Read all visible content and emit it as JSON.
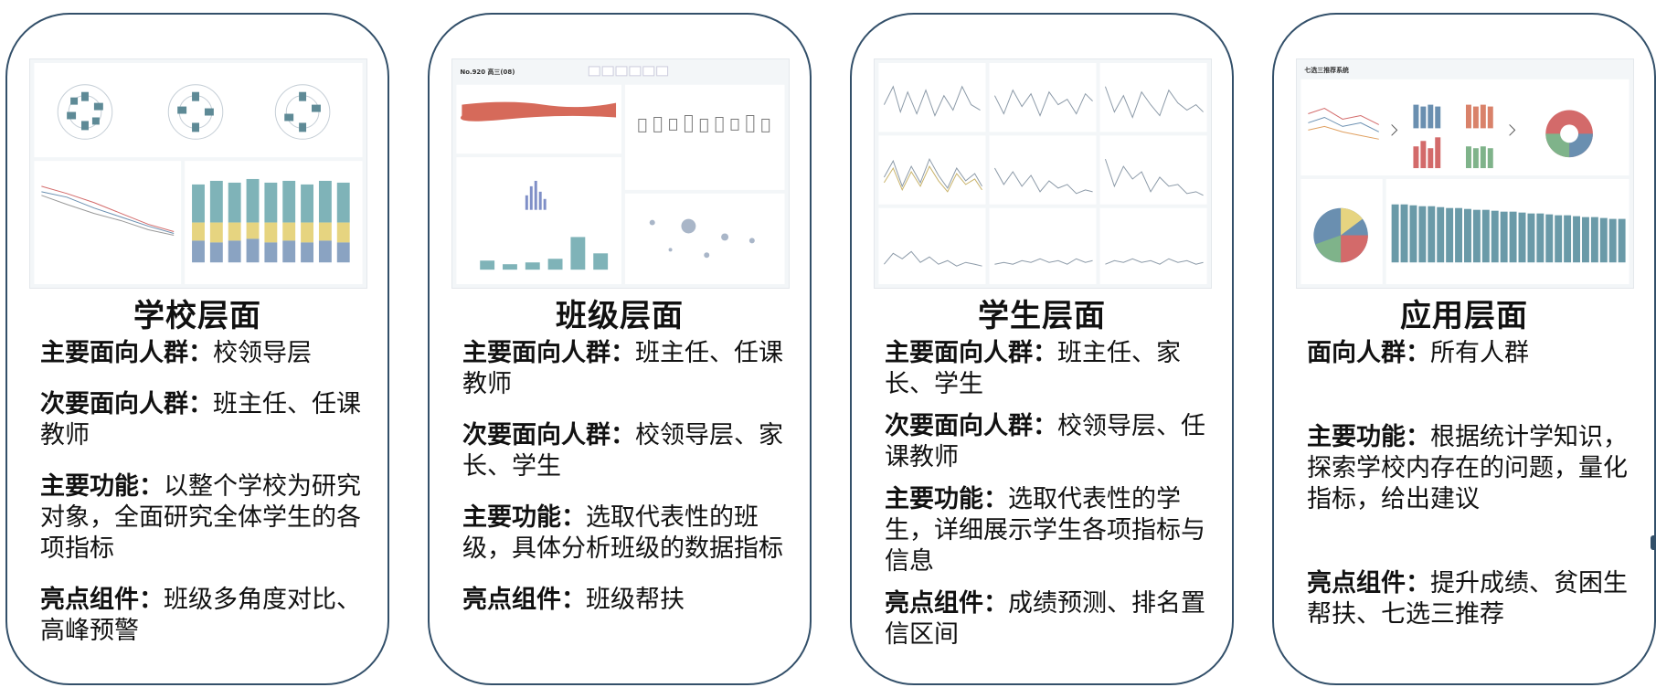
{
  "panels": [
    {
      "title": "学校层面",
      "items": [
        {
          "label": "主要面向人群：",
          "text": "校领导层"
        },
        {
          "label": "次要面向人群：",
          "text": "班主任、任课教师"
        },
        {
          "label": "主要功能：",
          "text": "以整个学校为研究对象，全面研究全体学生的各项指标"
        },
        {
          "label": "亮点组件：",
          "text": "班级多角度对比、高峰预警"
        }
      ]
    },
    {
      "title": "班级层面",
      "shot_header": "No.920 高三(08)",
      "items": [
        {
          "label": "主要面向人群：",
          "text": "班主任、任课教师"
        },
        {
          "label": "次要面向人群：",
          "text": "校领导层、家长、学生"
        },
        {
          "label": "主要功能：",
          "text": "选取代表性的班级，具体分析班级的数据指标"
        },
        {
          "label": "亮点组件：",
          "text": "班级帮扶"
        }
      ]
    },
    {
      "title": "学生层面",
      "items": [
        {
          "label": "主要面向人群：",
          "text": "班主任、家长、学生"
        },
        {
          "label": "次要面向人群：",
          "text": "校领导层、任课教师"
        },
        {
          "label": "主要功能：",
          "text": "选取代表性的学生，详细展示学生各项指标与信息"
        },
        {
          "label": "亮点组件：",
          "text": "成绩预测、排名置信区间"
        }
      ]
    },
    {
      "title": "应用层面",
      "shot_header": "七选三推荐系统",
      "items": [
        {
          "label": "面向人群：",
          "text": "所有人群"
        },
        {
          "label": "主要功能：",
          "text": "根据统计学知识，探索学校内存在的问题，量化指标，给出建议"
        },
        {
          "label": "亮点组件：",
          "text": "提升成绩、贫困生帮扶、七选三推荐"
        }
      ]
    }
  ]
}
